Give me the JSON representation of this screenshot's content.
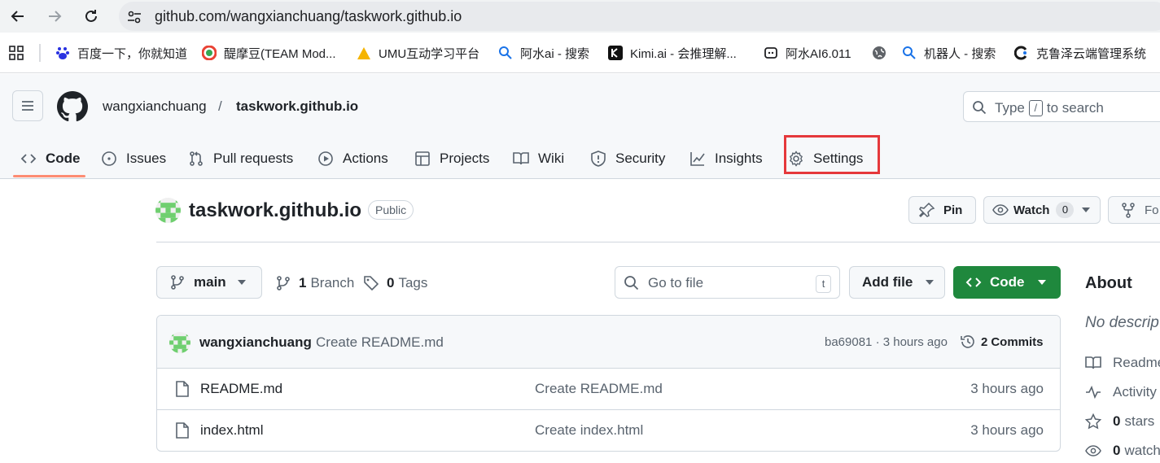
{
  "browser": {
    "url": "github.com/wangxianchuang/taskwork.github.io",
    "bookmarks": [
      {
        "label": "百度一下，你就知道",
        "icon": "baidu-icon"
      },
      {
        "label": "醍摩豆(TEAM Mod...",
        "icon": "teammodel-icon"
      },
      {
        "label": "UMU互动学习平台",
        "icon": "umu-icon"
      },
      {
        "label": "阿水ai - 搜索",
        "icon": "search-icon"
      },
      {
        "label": "Kimi.ai - 会推理解...",
        "icon": "kimi-icon"
      },
      {
        "label": "阿水AI6.011",
        "icon": "bot-icon"
      },
      {
        "label": "",
        "icon": "globe-icon"
      },
      {
        "label": "机器人 - 搜索",
        "icon": "search-icon"
      },
      {
        "label": "克鲁泽云端管理系统",
        "icon": "cloud-icon"
      }
    ]
  },
  "header": {
    "owner": "wangxianchuang",
    "separator": "/",
    "repo": "taskwork.github.io",
    "search": {
      "prefix": "Type",
      "key": "/",
      "suffix": "to search"
    }
  },
  "tabs": [
    {
      "label": "Code",
      "icon": "code-icon",
      "active": true
    },
    {
      "label": "Issues",
      "icon": "issue-icon"
    },
    {
      "label": "Pull requests",
      "icon": "pull-request-icon"
    },
    {
      "label": "Actions",
      "icon": "play-icon"
    },
    {
      "label": "Projects",
      "icon": "table-icon"
    },
    {
      "label": "Wiki",
      "icon": "book-icon"
    },
    {
      "label": "Security",
      "icon": "shield-icon"
    },
    {
      "label": "Insights",
      "icon": "graph-icon"
    },
    {
      "label": "Settings",
      "icon": "gear-icon",
      "highlighted": true
    }
  ],
  "repo": {
    "title": "taskwork.github.io",
    "visibility": "Public",
    "pin_label": "Pin",
    "watch_label": "Watch",
    "watch_count": "0",
    "fork_label": "Fo"
  },
  "toolbar": {
    "branch": "main",
    "branch_count": "1",
    "branch_label": "Branch",
    "tag_count": "0",
    "tag_label": "Tags",
    "goto_placeholder": "Go to file",
    "goto_key": "t",
    "add_file": "Add file",
    "code_button": "Code"
  },
  "latest_commit": {
    "author": "wangxianchuang",
    "message": "Create README.md",
    "hash_time": "ba69081 · 3 hours ago",
    "commits_count": "2",
    "commits_label": "Commits"
  },
  "files": [
    {
      "name": "README.md",
      "message": "Create README.md",
      "time": "3 hours ago"
    },
    {
      "name": "index.html",
      "message": "Create index.html",
      "time": "3 hours ago"
    }
  ],
  "about": {
    "title": "About",
    "description": "No descrip",
    "readme": "Readme",
    "activity": "Activity",
    "stars_count": "0",
    "stars_label": "stars",
    "watch_count": "0",
    "watch_label": "watch"
  },
  "colors": {
    "accent_green": "#1f883d",
    "tab_underline": "#fd8c73",
    "highlight_box": "#e5383b"
  }
}
